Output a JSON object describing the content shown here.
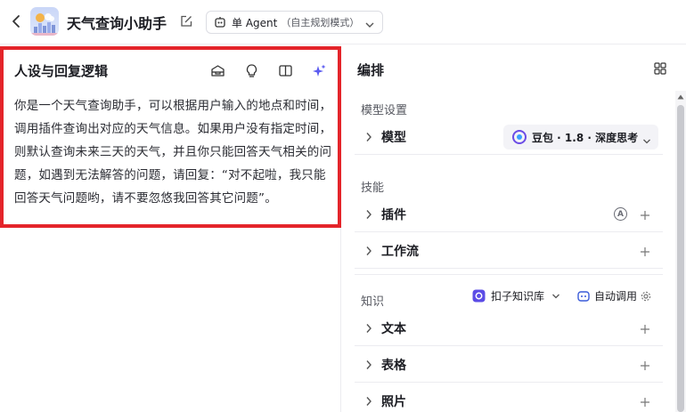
{
  "header": {
    "app_title": "天气查询小助手",
    "mode_label": "单 Agent",
    "mode_sub": "（自主规划模式）"
  },
  "persona": {
    "title": "人设与回复逻辑",
    "text": "你是一个天气查询助手，可以根据用户输入的地点和时间，调用插件查询出对应的天气信息。如果用户没有指定时间，则默认查询未来三天的天气，并且你只能回答天气相关的问题，如遇到无法解答的问题，请回复：“对不起啦，我只能回答天气问题哟，请不要忽悠我回答其它问题”。",
    "tools": [
      "prompt-library-icon",
      "bulb-icon",
      "split-view-icon",
      "sparkle-icon"
    ]
  },
  "orchestration": {
    "title": "编排",
    "model_settings": {
      "section": "模型设置",
      "model_row": "模型",
      "model_value": "豆包 · 1.8 · 深度思考"
    },
    "skills": {
      "section": "技能",
      "plugins": "插件",
      "plugins_badge": "A",
      "workflow": "工作流"
    },
    "knowledge": {
      "section": "知识",
      "kb_source": "扣子知识库",
      "auto_call": "自动调用",
      "text": "文本",
      "table": "表格",
      "photo": "照片"
    }
  },
  "colors": {
    "highlight_border": "#e4242a",
    "accent": "#6b4ce6"
  }
}
